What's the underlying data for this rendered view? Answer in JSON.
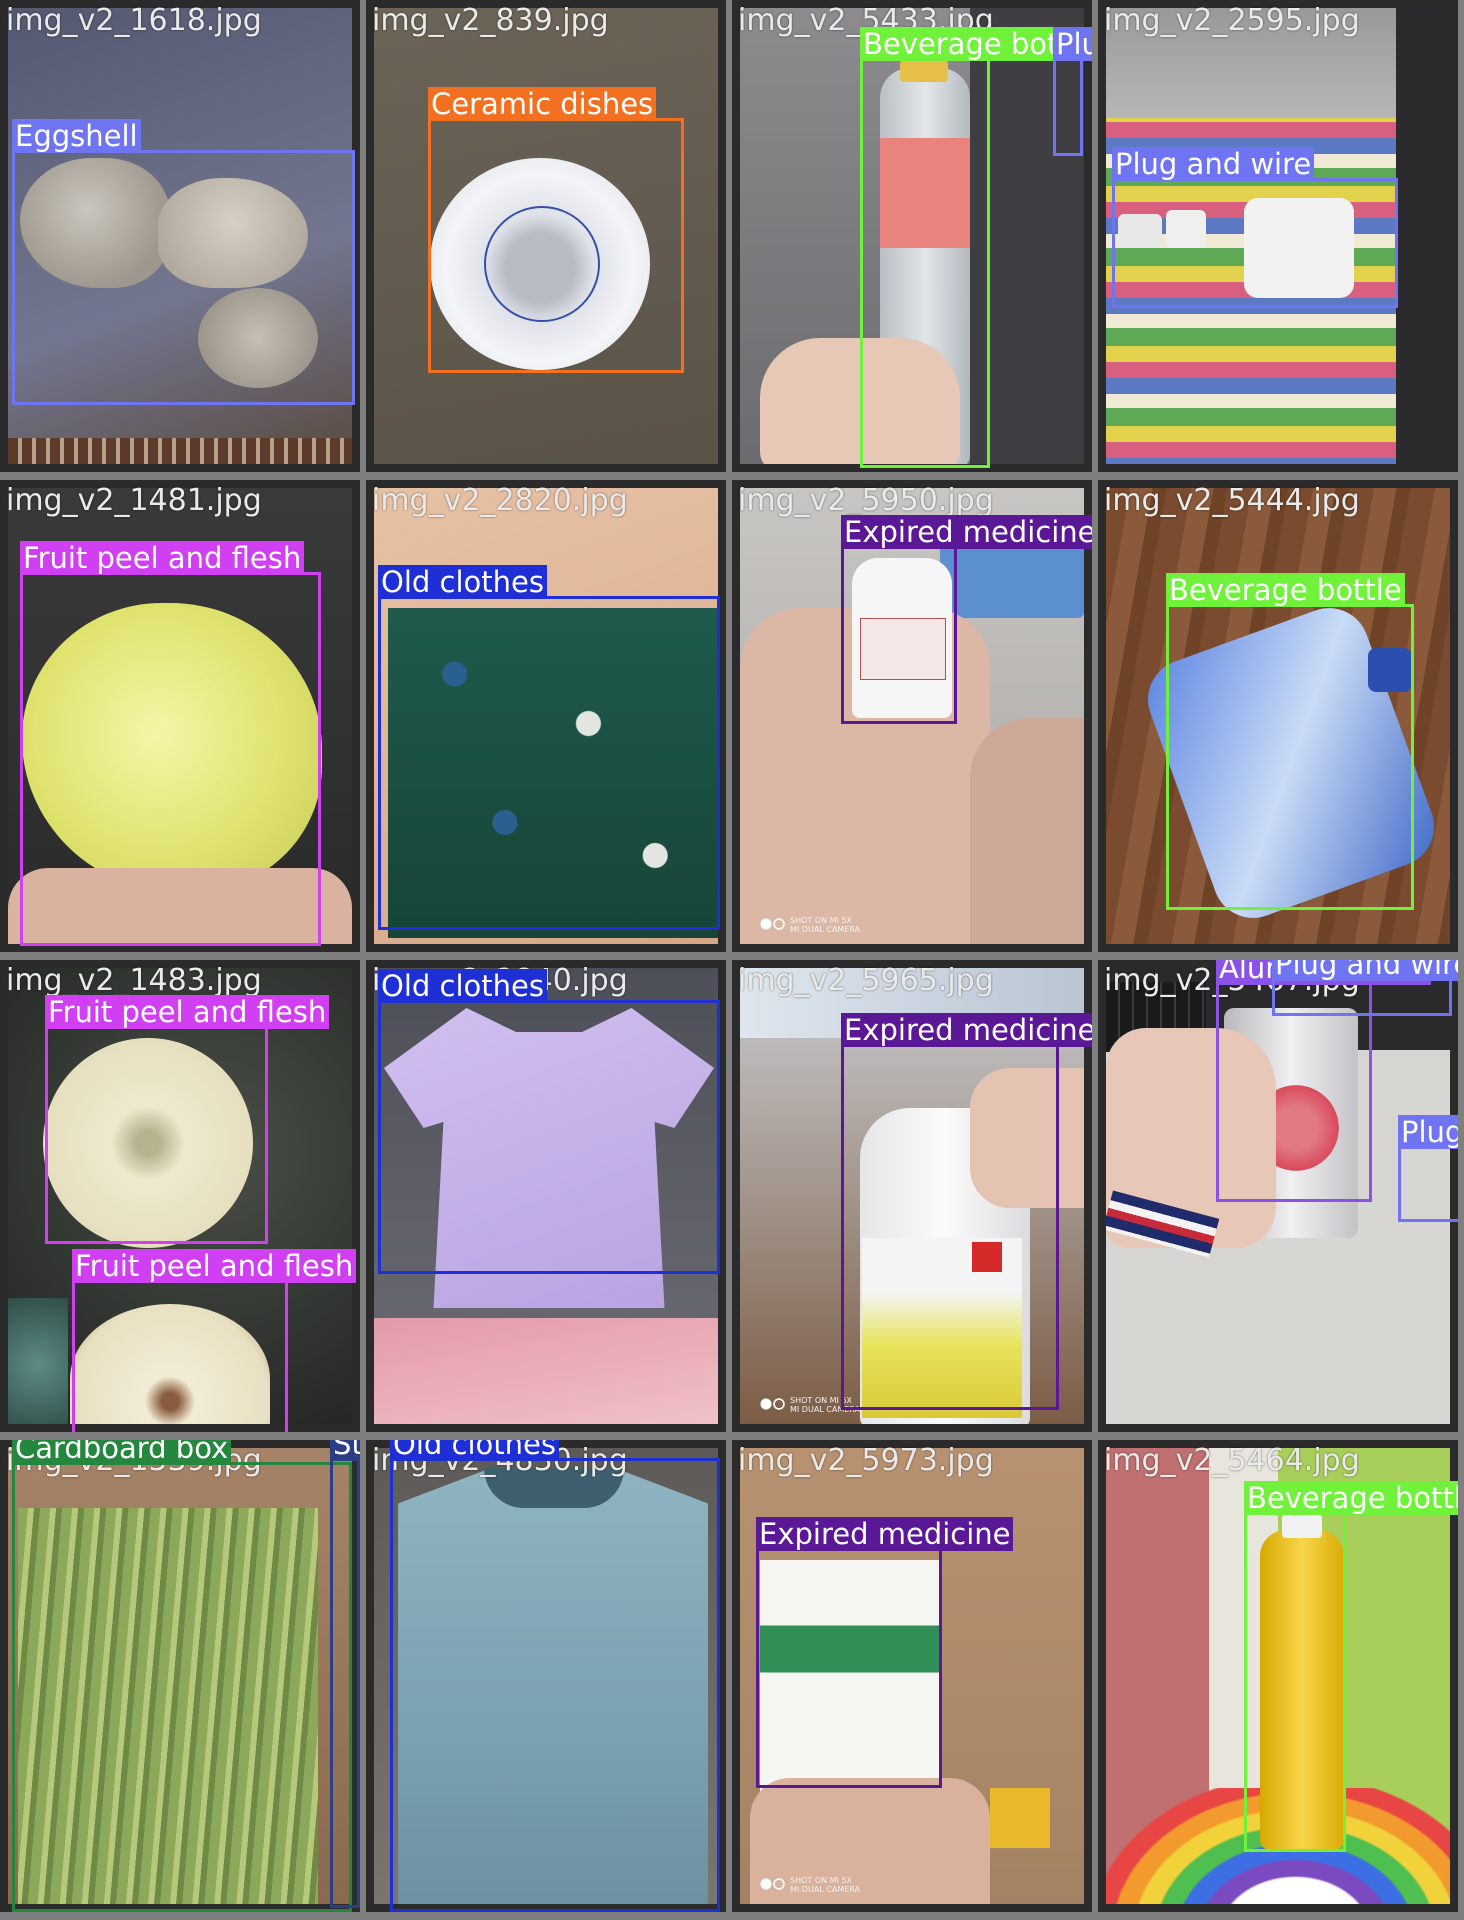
{
  "colors": {
    "Eggshell": "#6f75f2",
    "Ceramic dishes": "#f2701f",
    "Beverage bottle": "#71f23a",
    "Plug and wire": "#6f75f2",
    "Fruit peel and flesh": "#d13ff2",
    "Old clothes": "#1e2fd6",
    "Expired medicine": "#5a1896",
    "Aluminum can": "#8a52e6",
    "Cardboard box": "#25873d",
    "Stems and leaves": "#2c3e86"
  },
  "tiles": [
    {
      "filename": "img_v2_1618.jpg",
      "scene": "eggshell",
      "labels": {
        "b0": "Eggshell"
      }
    },
    {
      "filename": "img_v2_839.jpg",
      "scene": "bowl",
      "labels": {
        "b0": "Ceramic dishes"
      }
    },
    {
      "filename": "img_v2_5433.jpg",
      "scene": "bottle-hand",
      "labels": {
        "b0": "Beverage bot",
        "b1": "Plug and wire"
      }
    },
    {
      "filename": "img_v2_2595.jpg",
      "scene": "charger",
      "labels": {
        "b0": "Plug and wire"
      }
    },
    {
      "filename": "img_v2_1481.jpg",
      "scene": "potato",
      "labels": {
        "b0": "Fruit peel and flesh"
      }
    },
    {
      "filename": "img_v2_2820.jpg",
      "scene": "shorts",
      "labels": {
        "b0": "Old clothes"
      }
    },
    {
      "filename": "img_v2_5950.jpg",
      "scene": "pill-bottle",
      "labels": {
        "b0": "Expired medicine"
      },
      "camera": "SHOT ON MI 5X\nMI DUAL CAMERA"
    },
    {
      "filename": "img_v2_5444.jpg",
      "scene": "water-bottle",
      "labels": {
        "b0": "Beverage bottle"
      }
    },
    {
      "filename": "img_v2_1483.jpg",
      "scene": "apple",
      "labels": {
        "b0": "Fruit peel and flesh",
        "b1": "Fruit peel and flesh"
      }
    },
    {
      "filename": "img_v2_2840.jpg",
      "scene": "tshirt",
      "labels": {
        "b0": "Old clothes"
      }
    },
    {
      "filename": "img_v2_5965.jpg",
      "scene": "white-bottle",
      "labels": {
        "b0": "Expired medicine"
      },
      "camera": "SHOT ON MI 5X\nMI DUAL CAMERA"
    },
    {
      "filename": "img_v2_5467.jpg",
      "scene": "can",
      "labels": {
        "b0": "Aluminum can",
        "b1": "Plug and wire",
        "b2": "Plug"
      }
    },
    {
      "filename": "img_v2_1539.jpg",
      "scene": "asparagus",
      "labels": {
        "b0": "Cardboard box",
        "b1": "Stems and leaves"
      }
    },
    {
      "filename": "img_v2_4830.jpg",
      "scene": "blue-shirt",
      "labels": {
        "b0": "Old clothes"
      }
    },
    {
      "filename": "img_v2_5973.jpg",
      "scene": "medicine-box",
      "labels": {
        "b0": "Expired medicine"
      },
      "camera": "SHOT ON MI 5X\nMI DUAL CAMERA"
    },
    {
      "filename": "img_v2_5464.jpg",
      "scene": "yellow-bottle",
      "labels": {
        "b0": "Beverage bottle"
      }
    }
  ]
}
